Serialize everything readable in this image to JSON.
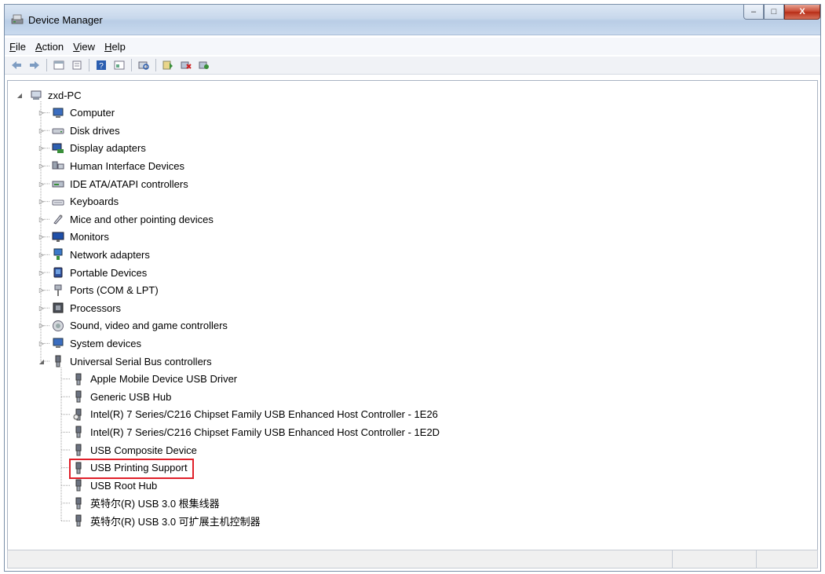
{
  "window": {
    "title": "Device Manager"
  },
  "window_buttons": {
    "minimize": "–",
    "maximize": "□",
    "close": "X"
  },
  "menu": [
    {
      "accel": "F",
      "rest": "ile"
    },
    {
      "accel": "A",
      "rest": "ction"
    },
    {
      "accel": "V",
      "rest": "iew"
    },
    {
      "accel": "H",
      "rest": "elp"
    }
  ],
  "toolbar": {
    "icons": [
      "back-icon",
      "forward-icon",
      "properties-icon",
      "update-icon",
      "help-icon",
      "view-icon",
      "scan-icon",
      "update-driver-icon",
      "uninstall-icon",
      "enable-icon"
    ]
  },
  "tree": {
    "root": "zxd-PC",
    "categories": [
      "Computer",
      "Disk drives",
      "Display adapters",
      "Human Interface Devices",
      "IDE ATA/ATAPI controllers",
      "Keyboards",
      "Mice and other pointing devices",
      "Monitors",
      "Network adapters",
      "Portable Devices",
      "Ports (COM & LPT)",
      "Processors",
      "Sound, video and game controllers",
      "System devices",
      "Universal Serial Bus controllers"
    ],
    "usb_children": [
      "Apple Mobile Device USB Driver",
      "Generic USB Hub",
      "Intel(R) 7 Series/C216 Chipset Family USB Enhanced Host Controller - 1E26",
      "Intel(R) 7 Series/C216 Chipset Family USB Enhanced Host Controller - 1E2D",
      "USB Composite Device",
      "USB Printing Support",
      "USB Root Hub",
      "英特尔(R) USB 3.0 根集线器",
      "英特尔(R) USB 3.0 可扩展主机控制器"
    ]
  },
  "colors": {
    "highlight_border": "#e0202a",
    "titlebar": "#c8d8ec"
  }
}
